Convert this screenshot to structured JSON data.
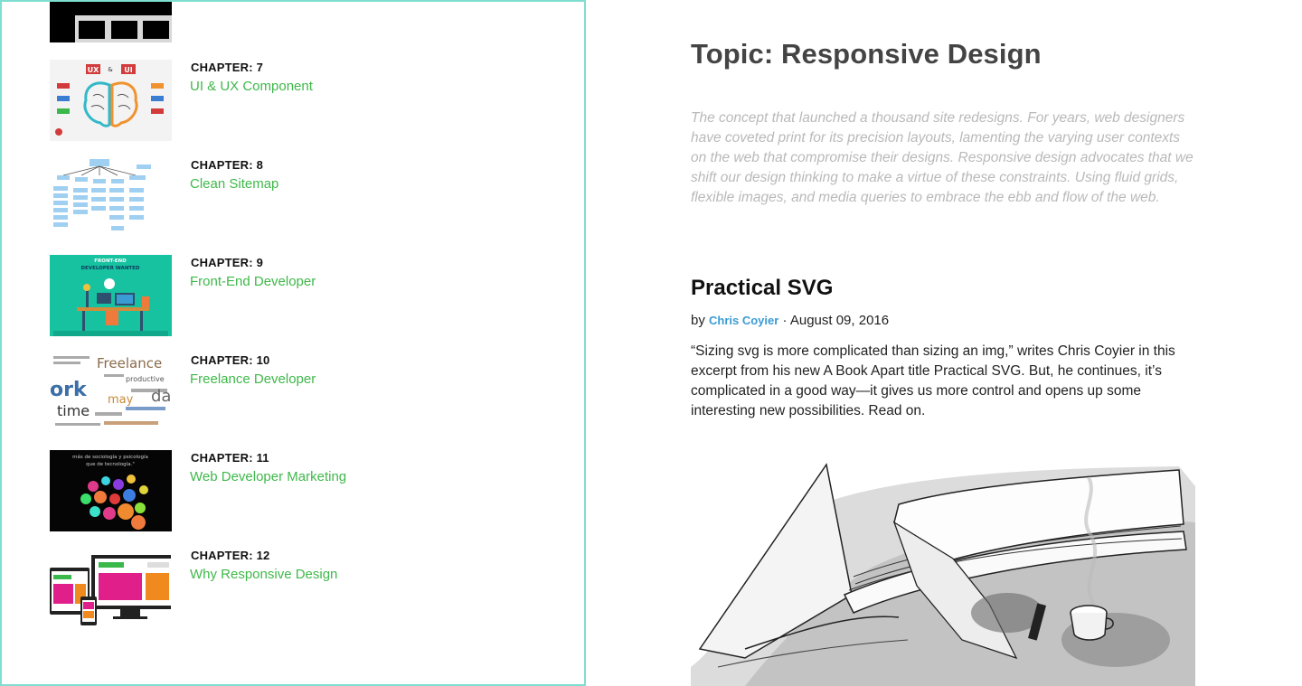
{
  "chapters": [
    {
      "label": "CHAPTER: 7",
      "title": "UI & UX Component",
      "thumb_text": [
        "UX",
        "&",
        "UI"
      ]
    },
    {
      "label": "CHAPTER: 8",
      "title": "Clean Sitemap"
    },
    {
      "label": "CHAPTER: 9",
      "title": "Front-End Developer",
      "thumb_text": [
        "FRONT-END",
        "DEVELOPER WANTED"
      ]
    },
    {
      "label": "CHAPTER: 10",
      "title": "Freelance Developer",
      "thumb_text": [
        "Freelance",
        "ork",
        "time",
        "may",
        "productive"
      ]
    },
    {
      "label": "CHAPTER: 11",
      "title": "Web Developer Marketing",
      "thumb_text": [
        "más de sociología y psicología",
        "que de tecnología.\""
      ]
    },
    {
      "label": "CHAPTER: 12",
      "title": "Why Responsive Design"
    }
  ],
  "topic": {
    "title": "Topic: Responsive Design",
    "description": "The concept that launched a thousand site redesigns. For years, web designers have coveted print for its precision layouts, lamenting the varying user contexts on the web that compromise their designs. Responsive design advocates that we shift our design thinking to make a virtue of these constraints. Using fluid grids, flexible images, and media queries to embrace the ebb and flow of the web."
  },
  "article": {
    "title": "Practical SVG",
    "by": "by",
    "author": "Chris Coyier",
    "separator": "·",
    "date": "August 09, 2016",
    "excerpt": "“Sizing svg is more complicated than sizing an img,” writes Chris Coyier in this excerpt from his new A Book Apart title Practical SVG. But, he continues, it’s complicated in a good way—it gives us more control and opens up some interesting new possibilities. Read on."
  },
  "colors": {
    "sidebar_border": "#7fded0",
    "chapter_title": "#3fb84a",
    "author_link": "#3a9bd4",
    "topic_desc": "#b9b9b9"
  }
}
